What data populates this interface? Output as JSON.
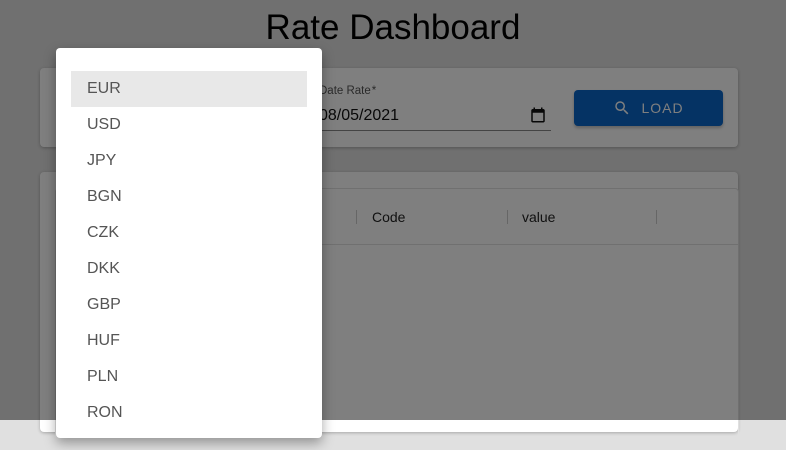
{
  "page": {
    "title": "Rate Dashboard"
  },
  "controls": {
    "date_label": "Date Rate",
    "date_required_mark": "*",
    "date_value": "08/05/2021",
    "load_label": "LOAD"
  },
  "table": {
    "columns": [
      "Code",
      "value"
    ]
  },
  "currency_menu": {
    "selected": "EUR",
    "options": [
      "EUR",
      "USD",
      "JPY",
      "BGN",
      "CZK",
      "DKK",
      "GBP",
      "HUF",
      "PLN",
      "RON"
    ]
  },
  "colors": {
    "primary": "#0a66c8",
    "selected_bg": "#e8e8e8"
  },
  "icons": {
    "load_button": "search-icon",
    "date_field": "calendar-icon"
  }
}
